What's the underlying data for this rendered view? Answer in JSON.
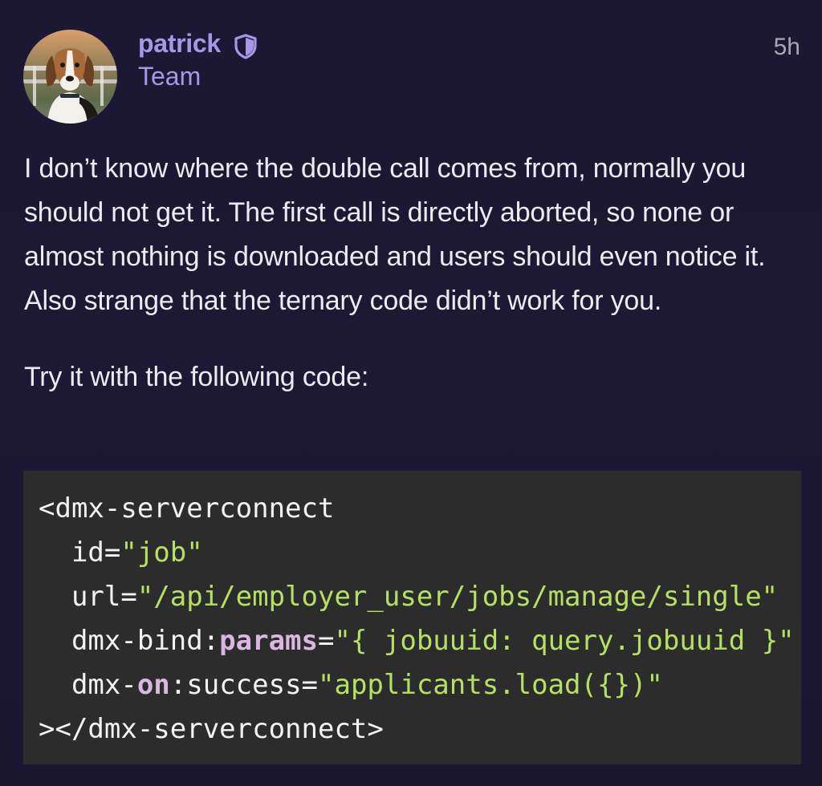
{
  "post": {
    "author": {
      "name": "patrick",
      "group": "Team",
      "badge_icon": "shield-icon",
      "avatar": "beagle-dog-photo"
    },
    "timestamp": "5h",
    "body": {
      "paragraph_1": "I don’t know where the double call comes from, normally you should not get it. The first call is directly aborted, so none or almost nothing is downloaded and users should even notice it. Also strange that the ternary code didn’t work for you.",
      "paragraph_2": "Try it with the following code:"
    },
    "code": {
      "line1": "<dmx-serverconnect",
      "line2_attr": "  id=",
      "line2_val": "\"job\"",
      "line3_attr": "  url=",
      "line3_val": "\"/api/employer_user/jobs/manage/single\"",
      "line4_pre": "  dmx-bind:",
      "line4_kw": "params",
      "line4_eq": "=",
      "line4_val": "\"{ jobuuid: query.jobuuid }\"",
      "line5_pre": "  dmx-",
      "line5_kw": "on",
      "line5_mid": ":success=",
      "line5_val": "\"applicants.load({})\"",
      "line6": "></dmx-serverconnect>"
    }
  },
  "colors": {
    "background": "#1c1733",
    "author": "#a798e6",
    "code_background": "#2c2c2c",
    "code_string": "#b6e063",
    "code_keyword": "#d9b8e0"
  }
}
